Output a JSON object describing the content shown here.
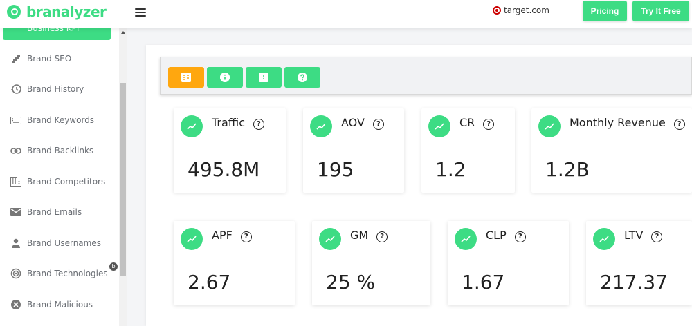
{
  "header": {
    "logo_text": "branalyzer",
    "domain": "target.com",
    "pricing_label": "Pricing",
    "try_label": "Try It Free"
  },
  "sidebar": {
    "active_label": "Business KPI",
    "items": [
      {
        "label": "Brand SEO",
        "icon": "stairs-icon"
      },
      {
        "label": "Brand History",
        "icon": "history-icon"
      },
      {
        "label": "Brand Keywords",
        "icon": "keyboard-icon"
      },
      {
        "label": "Brand Backlinks",
        "icon": "link-icon"
      },
      {
        "label": "Brand Competitors",
        "icon": "building-icon"
      },
      {
        "label": "Brand Emails",
        "icon": "email-icon"
      },
      {
        "label": "Brand Usernames",
        "icon": "person-icon"
      },
      {
        "label": "Brand Technologies",
        "icon": "target-circle-icon"
      },
      {
        "label": "Brand Malicious",
        "icon": "cancel-icon"
      }
    ],
    "tech_badge": "b"
  },
  "toolbar": {
    "buttons": [
      "dashboard-icon",
      "info-icon",
      "feedback-icon",
      "help-icon"
    ]
  },
  "kpis": [
    {
      "title": "Traffic",
      "value": "495.8M"
    },
    {
      "title": "AOV",
      "value": "195"
    },
    {
      "title": "CR",
      "value": "1.2"
    },
    {
      "title": "Monthly Revenue",
      "value": "1.2B"
    },
    {
      "title": "APF",
      "value": "2.67"
    },
    {
      "title": "GM",
      "value": "25 %"
    },
    {
      "title": "CLP",
      "value": "1.67"
    },
    {
      "title": "LTV",
      "value": "217.37"
    }
  ],
  "colors": {
    "accent": "#3ddc84",
    "orange": "#ffa70f"
  }
}
